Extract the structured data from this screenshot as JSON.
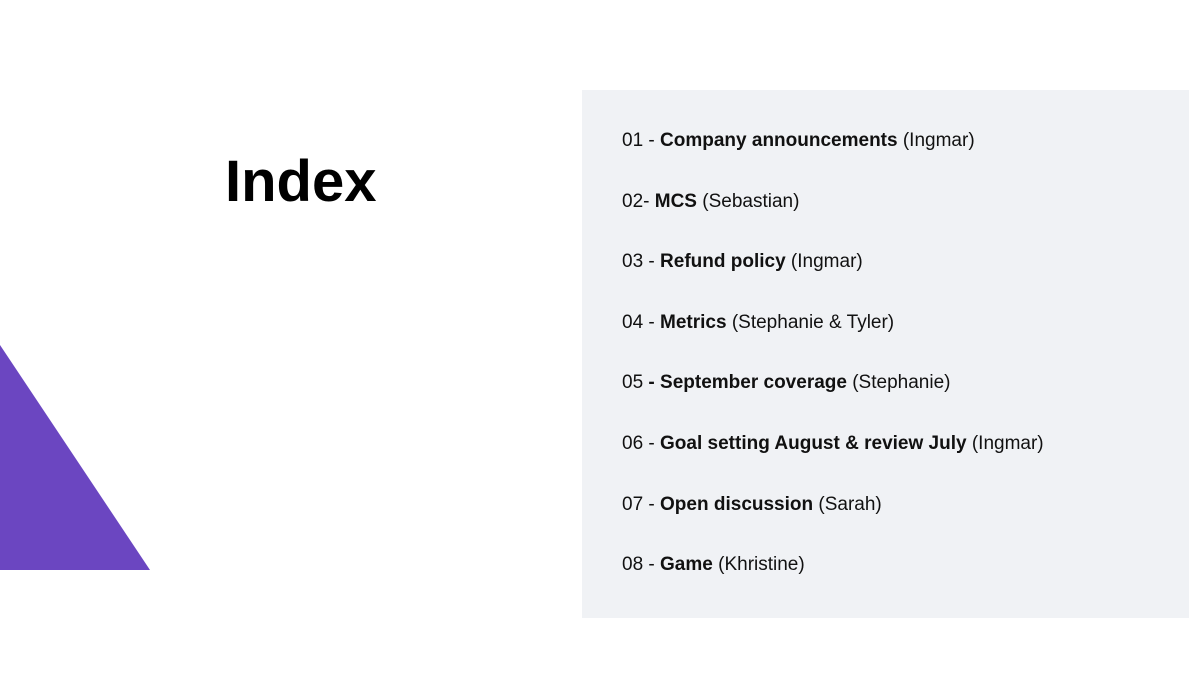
{
  "heading": "Index",
  "items": [
    {
      "num": "01 - ",
      "title": "Company announcements",
      "presenter": " (Ingmar)"
    },
    {
      "num": "02- ",
      "title": "MCS",
      "presenter": " (Sebastian)"
    },
    {
      "num": "03 - ",
      "title": "Refund policy",
      "presenter": " (Ingmar)"
    },
    {
      "num": "04 - ",
      "title": "Metrics",
      "presenter": " (Stephanie & Tyler)"
    },
    {
      "num": "05 ",
      "title": "- September coverage",
      "presenter": " (Stephanie)"
    },
    {
      "num": "06 - ",
      "title": "Goal setting August & review July",
      "presenter": " (Ingmar)"
    },
    {
      "num": "07 - ",
      "title": "Open discussion",
      "presenter": " (Sarah)"
    },
    {
      "num": "08 - ",
      "title": "Game",
      "presenter": " (Khristine)"
    }
  ]
}
